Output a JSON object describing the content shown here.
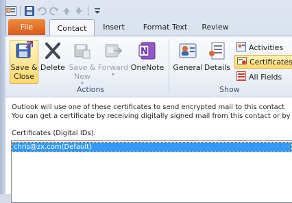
{
  "quick_access": {
    "icons": [
      "outlook-contact-icon",
      "save-icon",
      "undo-icon",
      "redo-icon",
      "up-arrow-icon",
      "down-arrow-icon",
      "customize-qat-icon"
    ]
  },
  "tabs": {
    "file": "File",
    "items": [
      "Contact",
      "Insert",
      "Format Text",
      "Review"
    ],
    "active": "Contact"
  },
  "ribbon": {
    "actions": {
      "label": "Actions",
      "save_close": [
        "Save &",
        "Close"
      ],
      "delete": "Delete",
      "save_new": [
        "Save &",
        "New"
      ],
      "forward": "Forward",
      "onenote": "OneNote"
    },
    "show": {
      "label": "Show",
      "general": "General",
      "details": "Details",
      "activities": "Activities",
      "certificates": "Certificates",
      "all_fields": "All Fields"
    }
  },
  "main": {
    "intro_line1": "Outlook will use one of these certificates to send encrypted mail to this contact",
    "intro_line2": "You can get a certificate by receiving digitally signed mail from this contact or by",
    "cert_label": "Certificates (Digital IDs):",
    "certificates": [
      "chris@zx.com(Default)"
    ]
  },
  "colors": {
    "file_tab": "#e0661f",
    "selection": "#3399ff",
    "highlight": "#ffd970"
  }
}
